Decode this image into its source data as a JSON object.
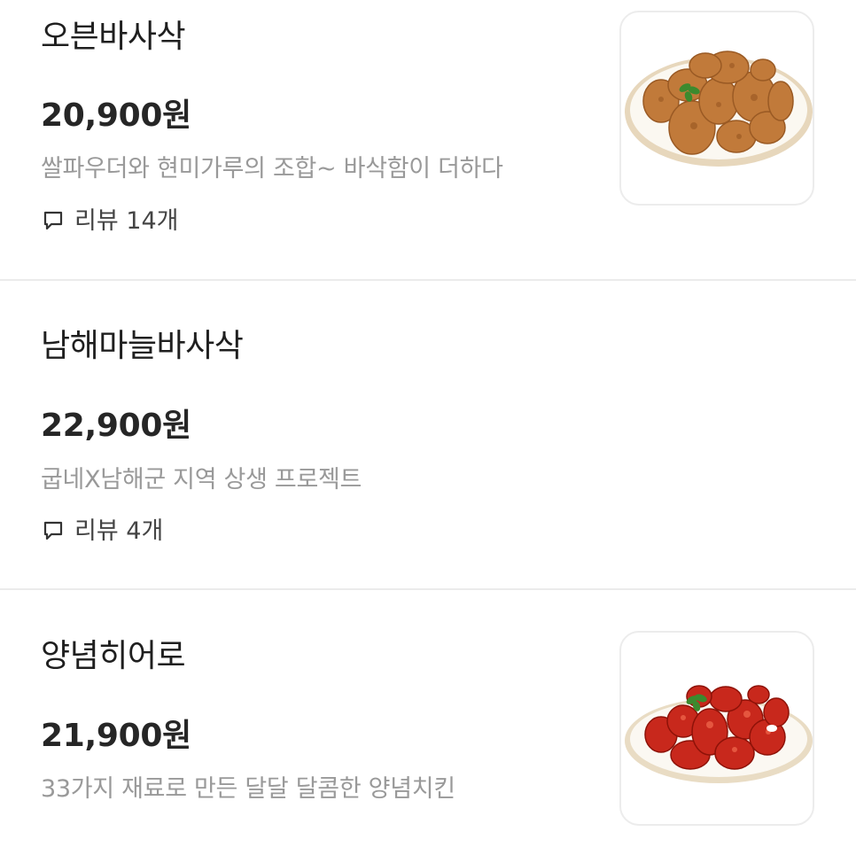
{
  "menu": {
    "items": [
      {
        "name": "오븐바사삭",
        "price": "20,900원",
        "description": "쌀파우더와 현미가루의 조합~ 바삭함이 더하다",
        "review": "리뷰 14개",
        "image": "oven-fried-chicken"
      },
      {
        "name": "남해마늘바사삭",
        "price": "22,900원",
        "description": "굽네X남해군 지역 상생 프로젝트",
        "review": "리뷰 4개"
      },
      {
        "name": "양념히어로",
        "price": "21,900원",
        "description": "33가지 재료로 만든 달달 달콤한 양념치킨",
        "image": "yangnyeom-chicken"
      }
    ]
  },
  "icons": {
    "review": "speech-bubble-icon"
  },
  "colors": {
    "text_primary": "#1f1f1f",
    "text_secondary": "#999999",
    "divider": "#ebebeb"
  }
}
